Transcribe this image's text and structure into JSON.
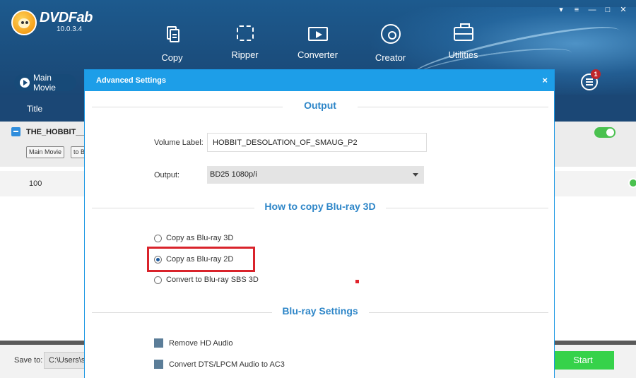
{
  "app": {
    "name": "DVDFab",
    "version": "10.0.3.4",
    "window_controls": [
      "pin",
      "menu",
      "minimize",
      "maximize",
      "close"
    ]
  },
  "nav": {
    "items": [
      {
        "label": "Copy",
        "icon": "copy-icon"
      },
      {
        "label": "Ripper",
        "icon": "ripper-icon"
      },
      {
        "label": "Converter",
        "icon": "converter-icon"
      },
      {
        "label": "Creator",
        "icon": "creator-icon"
      },
      {
        "label": "Utilities",
        "icon": "utilities-icon"
      }
    ]
  },
  "toolbar": {
    "main_movie_label": "Main Movie",
    "queue_badge": "1"
  },
  "list": {
    "column_title": "Title",
    "movie_name": "THE_HOBBIT__T",
    "tags": [
      "Main Movie",
      "to B"
    ],
    "row_value": "100"
  },
  "bottom": {
    "save_to_label": "Save to:",
    "save_path": "C:\\Users\\s",
    "start_label": "Start"
  },
  "dialog": {
    "title": "Advanced Settings",
    "close": "×",
    "output_section": "Output",
    "volume_label_label": "Volume Label:",
    "volume_label_value": "HOBBIT_DESOLATION_OF_SMAUG_P2",
    "output_label": "Output:",
    "output_value": "BD25 1080p/i",
    "copy_section": "How to copy Blu-ray 3D",
    "copy_options": [
      {
        "label": "Copy as Blu-ray 3D",
        "selected": false
      },
      {
        "label": "Copy as Blu-ray 2D",
        "selected": true
      },
      {
        "label": "Convert to Blu-ray SBS 3D",
        "selected": false
      }
    ],
    "bluray_section": "Blu-ray Settings",
    "bluray_options": [
      {
        "label": "Remove HD Audio"
      },
      {
        "label": "Convert DTS/LPCM Audio to AC3"
      }
    ]
  },
  "colors": {
    "header_bg": "#1b4f7f",
    "dialog_accent": "#1d9ee8",
    "section_title": "#2e86c8",
    "highlight": "#d9232b",
    "start_button": "#36d24a"
  }
}
